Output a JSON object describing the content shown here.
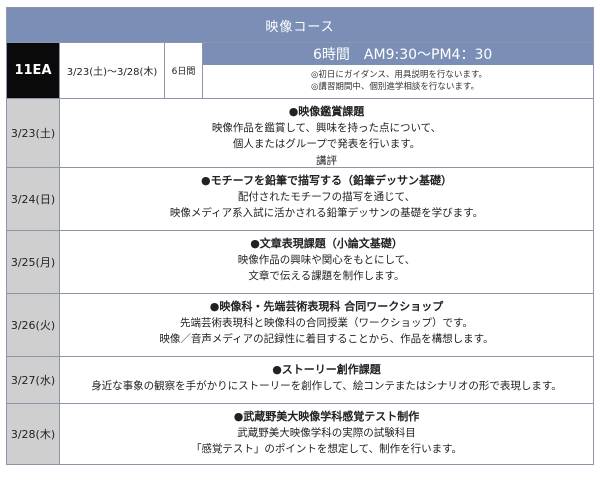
{
  "title": "映像コース",
  "course": {
    "code": "11EA",
    "date_range": "3/23(土)～3/28(木)",
    "days": "6日間",
    "hours": "6時間",
    "time": "AM9:30～PM4：30",
    "notes": [
      "◎初日にガイダンス、用具説明を行ないます。",
      "◎講習期間中、個別進学相談を行ないます。"
    ]
  },
  "schedule": [
    {
      "date": "3/23(土)",
      "title": "●映像鑑賞課題",
      "lines": [
        "映像作品を鑑賞して、興味を持った点について、",
        "個人またはグループで発表を行います。",
        "講評"
      ]
    },
    {
      "date": "3/24(日)",
      "title": "●モチーフを鉛筆で描写する（鉛筆デッサン基礎）",
      "lines": [
        "配付されたモチーフの描写を通じて、",
        "映像メディア系入試に活かされる鉛筆デッサンの基礎を学びます。"
      ]
    },
    {
      "date": "3/25(月)",
      "title": "●文章表現課題（小論文基礎）",
      "lines": [
        "映像作品の興味や関心をもとにして、",
        "文章で伝える課題を制作します。"
      ]
    },
    {
      "date": "3/26(火)",
      "title": "●映像科・先端芸術表現科 合同ワークショップ",
      "lines": [
        "先端芸術表現科と映像科の合同授業（ワークショップ）です。",
        "映像／音声メディアの記録性に着目することから、作品を構想します。"
      ]
    },
    {
      "date": "3/27(水)",
      "title": "●ストーリー創作課題",
      "lines": [
        "身近な事象の観察を手がかりにストーリーを創作して、絵コンテまたはシナリオの形で表現します。"
      ]
    },
    {
      "date": "3/28(木)",
      "title": "●武蔵野美大映像学科感覚テスト制作",
      "lines": [
        "武蔵野美大映像学科の実際の試験科目",
        "「感覚テスト」のポイントを想定して、制作を行います。"
      ]
    }
  ]
}
